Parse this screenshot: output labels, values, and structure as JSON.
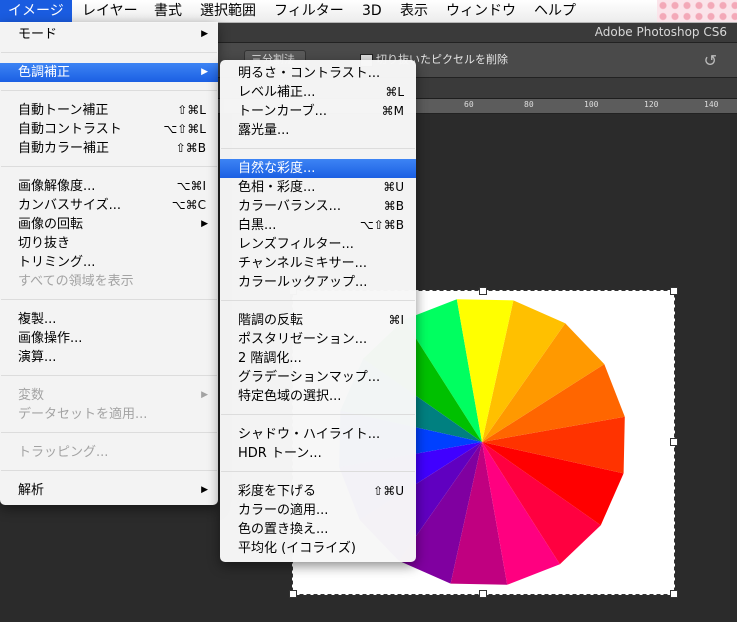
{
  "menubar": {
    "items": [
      {
        "label": "イメージ",
        "active": true
      },
      {
        "label": "レイヤー"
      },
      {
        "label": "書式"
      },
      {
        "label": "選択範囲"
      },
      {
        "label": "フィルター"
      },
      {
        "label": "3D"
      },
      {
        "label": "表示"
      },
      {
        "label": "ウィンドウ"
      },
      {
        "label": "ヘルプ"
      }
    ]
  },
  "app": {
    "title": "Adobe Photoshop CS6",
    "options_dropdown": "三分割法",
    "options_checkbox_label": "切り抜いたピクセルを削除"
  },
  "ruler": {
    "labels": [
      "60",
      "80",
      "100",
      "120",
      "140"
    ]
  },
  "image_menu": {
    "items": [
      {
        "label": "モード",
        "submenu": true
      },
      {
        "label": "色調補正",
        "submenu": true,
        "highlighted": true
      },
      {
        "label": "自動トーン補正",
        "shortcut": "⇧⌘L"
      },
      {
        "label": "自動コントラスト",
        "shortcut": "⌥⇧⌘L"
      },
      {
        "label": "自動カラー補正",
        "shortcut": "⇧⌘B"
      },
      {
        "label": "画像解像度...",
        "shortcut": "⌥⌘I"
      },
      {
        "label": "カンバスサイズ...",
        "shortcut": "⌥⌘C"
      },
      {
        "label": "画像の回転",
        "submenu": true
      },
      {
        "label": "切り抜き"
      },
      {
        "label": "トリミング..."
      },
      {
        "label": "すべての領域を表示",
        "disabled": true
      },
      {
        "label": "複製..."
      },
      {
        "label": "画像操作..."
      },
      {
        "label": "演算..."
      },
      {
        "label": "変数",
        "submenu": true,
        "disabled": true
      },
      {
        "label": "データセットを適用...",
        "disabled": true
      },
      {
        "label": "トラッピング...",
        "disabled": true
      },
      {
        "label": "解析",
        "submenu": true
      }
    ]
  },
  "adjust_menu": {
    "items": [
      {
        "label": "明るさ・コントラスト..."
      },
      {
        "label": "レベル補正...",
        "shortcut": "⌘L"
      },
      {
        "label": "トーンカーブ...",
        "shortcut": "⌘M"
      },
      {
        "label": "露光量..."
      },
      {
        "label": "自然な彩度...",
        "highlighted": true
      },
      {
        "label": "色相・彩度...",
        "shortcut": "⌘U"
      },
      {
        "label": "カラーバランス...",
        "shortcut": "⌘B"
      },
      {
        "label": "白黒...",
        "shortcut": "⌥⇧⌘B"
      },
      {
        "label": "レンズフィルター..."
      },
      {
        "label": "チャンネルミキサー..."
      },
      {
        "label": "カラールックアップ..."
      },
      {
        "label": "階調の反転",
        "shortcut": "⌘I"
      },
      {
        "label": "ポスタリゼーション..."
      },
      {
        "label": "2 階調化..."
      },
      {
        "label": "グラデーションマップ..."
      },
      {
        "label": "特定色域の選択..."
      },
      {
        "label": "シャドウ・ハイライト..."
      },
      {
        "label": "HDR トーン..."
      },
      {
        "label": "彩度を下げる",
        "shortcut": "⇧⌘U"
      },
      {
        "label": "カラーの適用..."
      },
      {
        "label": "色の置き換え..."
      },
      {
        "label": "平均化 (イコライズ)"
      }
    ]
  },
  "color_wheel": {
    "colors": [
      "#ffff00",
      "#ffc000",
      "#ff9900",
      "#ff6600",
      "#ff3300",
      "#ff0000",
      "#ff0040",
      "#ff0080",
      "#c00080",
      "#8000a0",
      "#6000c0",
      "#4000ff",
      "#0040ff",
      "#008080",
      "#00c000",
      "#00ff60"
    ]
  }
}
